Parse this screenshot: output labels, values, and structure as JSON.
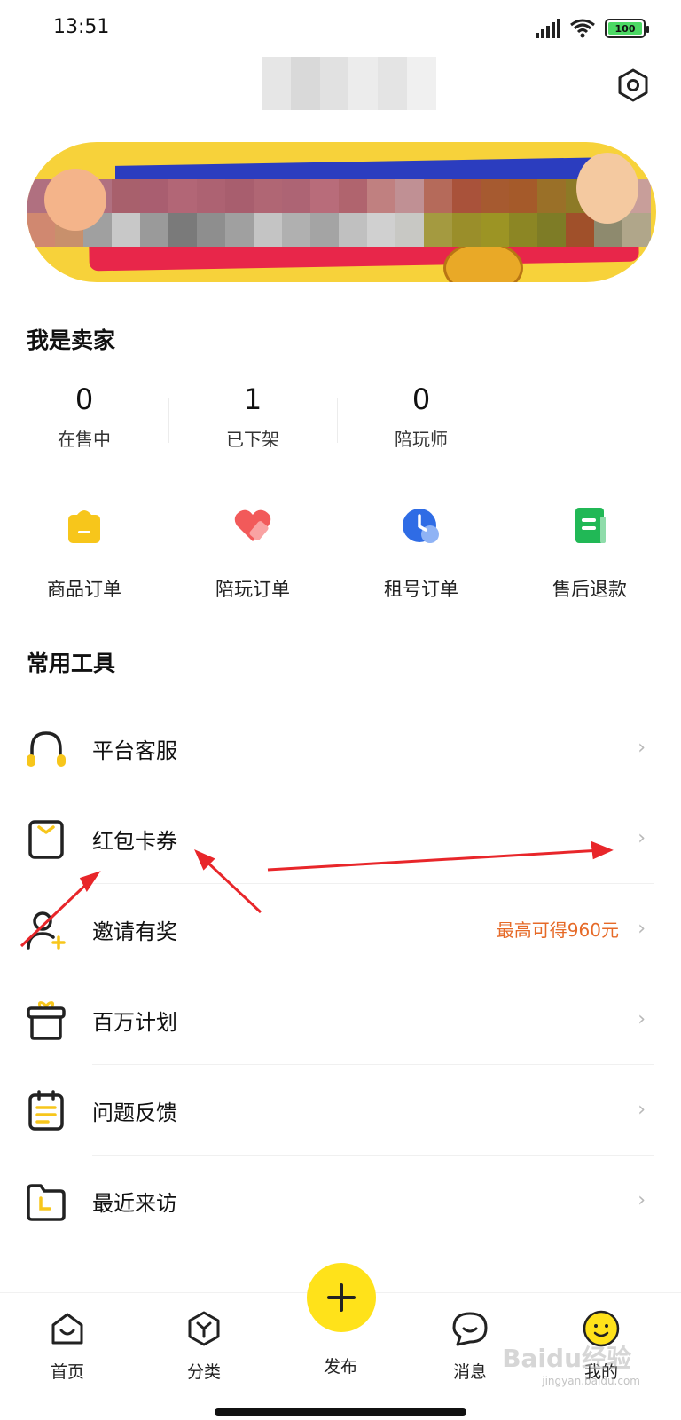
{
  "status_bar": {
    "time": "13:51",
    "battery": "100"
  },
  "colors": {
    "accent": "#ffe21a",
    "icon_yellow": "#f7c61b",
    "promo_orange": "#e66a28",
    "chevron": "#b8b8b8"
  },
  "header": {
    "settings_icon": "hexagon-settings-icon"
  },
  "seller": {
    "title": "我是卖家",
    "stats": [
      {
        "value": "0",
        "label": "在售中"
      },
      {
        "value": "1",
        "label": "已下架"
      },
      {
        "value": "0",
        "label": "陪玩师"
      }
    ],
    "orders": [
      {
        "label": "商品订单",
        "icon": "shopping-bag-icon"
      },
      {
        "label": "陪玩订单",
        "icon": "heart-tag-icon"
      },
      {
        "label": "租号订单",
        "icon": "clock-icon"
      },
      {
        "label": "售后退款",
        "icon": "document-icon"
      }
    ]
  },
  "tools": {
    "title": "常用工具",
    "items": [
      {
        "label": "平台客服",
        "icon": "headphones-icon",
        "extra": ""
      },
      {
        "label": "红包卡券",
        "icon": "coupon-icon",
        "extra": ""
      },
      {
        "label": "邀请有奖",
        "icon": "add-user-icon",
        "extra": "最高可得960元"
      },
      {
        "label": "百万计划",
        "icon": "gift-box-icon",
        "extra": ""
      },
      {
        "label": "问题反馈",
        "icon": "feedback-icon",
        "extra": ""
      },
      {
        "label": "最近来访",
        "icon": "folder-clock-icon",
        "extra": ""
      }
    ]
  },
  "tab_bar": {
    "items": [
      {
        "label": "首页",
        "icon": "home-icon"
      },
      {
        "label": "分类",
        "icon": "category-icon"
      },
      {
        "label": "发布",
        "icon": "plus-icon"
      },
      {
        "label": "消息",
        "icon": "message-icon"
      },
      {
        "label": "我的",
        "icon": "smiley-icon"
      }
    ]
  },
  "watermark": {
    "text": "Baidu经验",
    "sub": "jingyan.baidu.com"
  }
}
